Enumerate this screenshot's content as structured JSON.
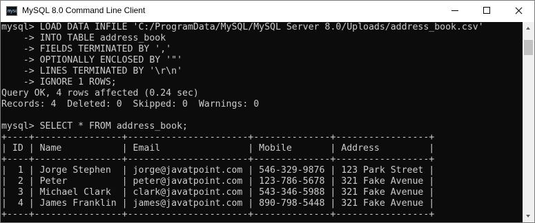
{
  "window": {
    "title": "MySQL 8.0 Command Line Client",
    "icon": "mysql-console-icon",
    "icon_glyph": "mysql",
    "minimize_icon": "minimize-icon",
    "maximize_icon": "maximize-icon",
    "close_icon": "close-icon"
  },
  "console": {
    "background": "#0c0c0c",
    "foreground": "#cccccc",
    "lines": [
      "mysql> LOAD DATA INFILE 'C:/ProgramData/MySQL/MySQL Server 8.0/Uploads/address_book.csv'",
      "    -> INTO TABLE address_book",
      "    -> FIELDS TERMINATED BY ','",
      "    -> OPTIONALLY ENCLOSED BY '\"'",
      "    -> LINES TERMINATED BY '\\r\\n'",
      "    -> IGNORE 1 ROWS;",
      "Query OK, 4 rows affected (0.24 sec)",
      "Records: 4  Deleted: 0  Skipped: 0  Warnings: 0",
      "",
      "mysql> SELECT * FROM address_book;",
      "+----+----------------+----------------------+--------------+-----------------+",
      "| ID | Name           | Email                | Mobile       | Address         |",
      "+----+----------------+----------------------+--------------+-----------------+",
      "|  1 | Jorge Stephen  | jorge@javatpoint.com | 546-329-9876 | 123 Park Street |",
      "|  2 | Peter          | peter@javatpoint.com | 123-786-5678 | 321 Fake Avenue |",
      "|  3 | Michael Clark  | clark@javatpoint.com | 543-346-5988 | 321 Fake Avenue |",
      "|  4 | James Franklin | james@javatpoint.com | 890-798-5448 | 321 Fake Avenue |",
      "+----+----------------+----------------------+--------------+-----------------+"
    ]
  },
  "scrollbar": {
    "up_icon": "scroll-up-arrow-icon",
    "down_icon": "scroll-down-arrow-icon"
  }
}
